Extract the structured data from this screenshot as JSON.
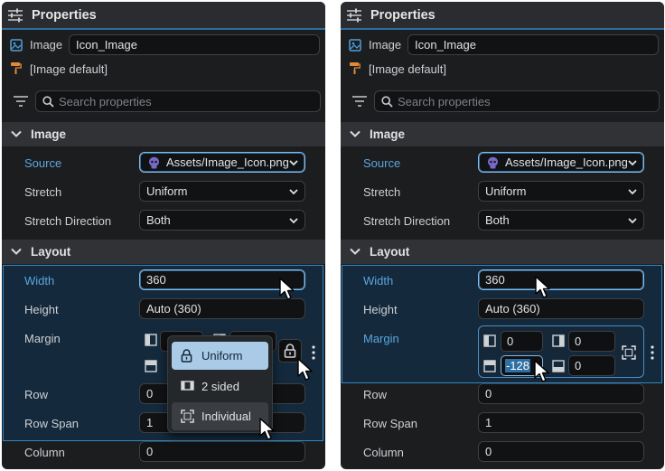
{
  "header": {
    "title": "Properties"
  },
  "component": {
    "type_label": "Image",
    "name_value": "Icon_Image",
    "style_label": "[Image default]"
  },
  "search": {
    "placeholder": "Search properties"
  },
  "sections": {
    "image": "Image",
    "layout": "Layout"
  },
  "image_props": {
    "source_label": "Source",
    "source_value": "Assets/Image_Icon.png",
    "stretch_label": "Stretch",
    "stretch_value": "Uniform",
    "stretch_dir_label": "Stretch Direction",
    "stretch_dir_value": "Both"
  },
  "layout_props": {
    "width_label": "Width",
    "width_value": "360",
    "height_label": "Height",
    "height_value": "Auto (360)",
    "margin_label": "Margin",
    "row_label": "Row",
    "row_value": "0",
    "rowspan_label": "Row Span",
    "rowspan_value": "1",
    "column_label": "Column",
    "column_value": "0"
  },
  "margin_popup": {
    "items": [
      "Uniform",
      "2 sided",
      "Individual"
    ]
  },
  "margin_values": {
    "left": "0",
    "right": "0",
    "top": "-128",
    "bottom": "0"
  },
  "colors": {
    "accent": "#2f86c6",
    "label_highlight": "#5ba6e0",
    "panel_bg": "#1c1d1f"
  },
  "icons": [
    "sliders-icon",
    "image-icon",
    "paint-roller-icon",
    "filter-icon",
    "search-icon",
    "chevron-down-icon",
    "lock-icon",
    "more-vertical-icon",
    "margin-side-icons",
    "cursor-icon"
  ]
}
